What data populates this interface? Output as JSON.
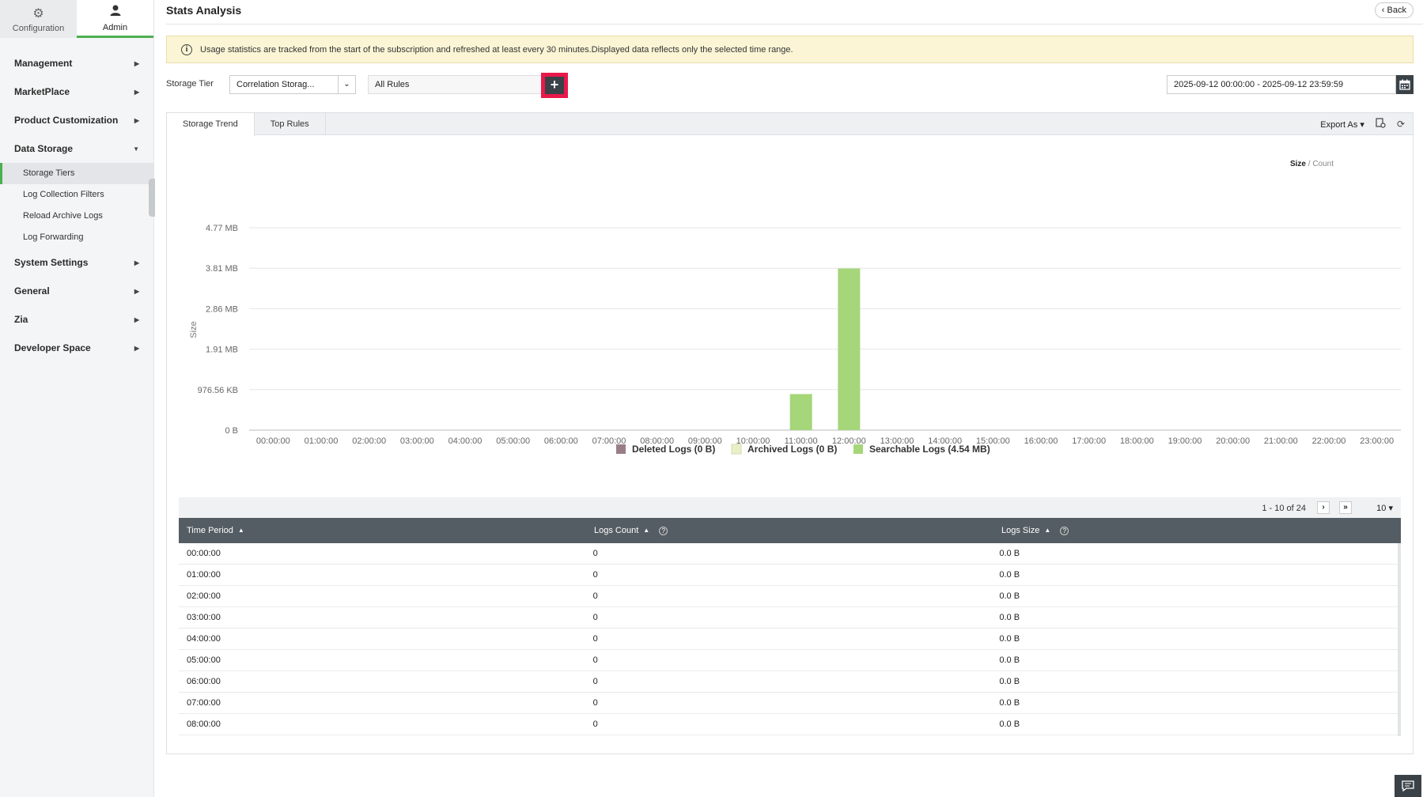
{
  "sidebar": {
    "tabs": [
      {
        "label": "Configuration",
        "icon": "gear-icon"
      },
      {
        "label": "Admin",
        "icon": "user-icon"
      }
    ],
    "items": [
      {
        "label": "Management"
      },
      {
        "label": "MarketPlace"
      },
      {
        "label": "Product Customization"
      },
      {
        "label": "Data Storage"
      },
      {
        "label": "System Settings"
      },
      {
        "label": "General"
      },
      {
        "label": "Zia"
      },
      {
        "label": "Developer Space"
      }
    ],
    "data_storage_sub": [
      "Storage Tiers",
      "Log Collection Filters",
      "Reload Archive Logs",
      "Log Forwarding"
    ]
  },
  "header": {
    "title": "Stats Analysis",
    "back_label": "Back"
  },
  "banner": {
    "text": "Usage statistics are tracked from the start of the subscription and refreshed at least every 30 minutes.Displayed data reflects only the selected time range."
  },
  "filters": {
    "storage_tier_label": "Storage Tier",
    "storage_tier_value": "Correlation Storag...",
    "rules_value": "All Rules",
    "date_range": "2025-09-12 00:00:00 - 2025-09-12 23:59:59"
  },
  "panel": {
    "tabs": [
      "Storage Trend",
      "Top Rules"
    ],
    "export_label": "Export As",
    "toggle_active": "Size",
    "toggle_sep": "/",
    "toggle_other": "Count"
  },
  "colors": {
    "searchable": "#a5d67a",
    "archived": "#e8f0c8",
    "deleted": "#9a7e86",
    "header_bg": "#545d63",
    "accent": "#4caf50",
    "highlight": "#e8194a"
  },
  "chart_data": {
    "type": "bar",
    "ylabel": "Size",
    "y_ticks": [
      "0 B",
      "976.56 KB",
      "1.91 MB",
      "2.86 MB",
      "3.81 MB",
      "4.77 MB"
    ],
    "ylim_mb": [
      0,
      4.77
    ],
    "categories": [
      "00:00:00",
      "01:00:00",
      "02:00:00",
      "03:00:00",
      "04:00:00",
      "05:00:00",
      "06:00:00",
      "07:00:00",
      "08:00:00",
      "09:00:00",
      "10:00:00",
      "11:00:00",
      "12:00:00",
      "13:00:00",
      "14:00:00",
      "15:00:00",
      "16:00:00",
      "17:00:00",
      "18:00:00",
      "19:00:00",
      "20:00:00",
      "21:00:00",
      "22:00:00",
      "23:00:00"
    ],
    "series": [
      {
        "name": "Deleted Logs (0 B)",
        "values_mb": [
          0,
          0,
          0,
          0,
          0,
          0,
          0,
          0,
          0,
          0,
          0,
          0,
          0,
          0,
          0,
          0,
          0,
          0,
          0,
          0,
          0,
          0,
          0,
          0
        ]
      },
      {
        "name": "Archived Logs (0 B)",
        "values_mb": [
          0,
          0,
          0,
          0,
          0,
          0,
          0,
          0,
          0,
          0,
          0,
          0,
          0,
          0,
          0,
          0,
          0,
          0,
          0,
          0,
          0,
          0,
          0,
          0
        ]
      },
      {
        "name": "Searchable Logs (4.54 MB)",
        "values_mb": [
          0,
          0,
          0,
          0,
          0,
          0,
          0,
          0,
          0,
          0,
          0,
          0.85,
          3.81,
          0,
          0,
          0,
          0,
          0,
          0,
          0,
          0,
          0,
          0,
          0
        ]
      }
    ],
    "legend_position": "bottom",
    "grid": true
  },
  "table": {
    "pager_info": "1 - 10 of 24",
    "per_page": "10",
    "columns": [
      "Time Period",
      "Logs Count",
      "Logs Size"
    ],
    "rows": [
      [
        "00:00:00",
        "0",
        "0.0 B"
      ],
      [
        "01:00:00",
        "0",
        "0.0 B"
      ],
      [
        "02:00:00",
        "0",
        "0.0 B"
      ],
      [
        "03:00:00",
        "0",
        "0.0 B"
      ],
      [
        "04:00:00",
        "0",
        "0.0 B"
      ],
      [
        "05:00:00",
        "0",
        "0.0 B"
      ],
      [
        "06:00:00",
        "0",
        "0.0 B"
      ],
      [
        "07:00:00",
        "0",
        "0.0 B"
      ],
      [
        "08:00:00",
        "0",
        "0.0 B"
      ]
    ]
  }
}
